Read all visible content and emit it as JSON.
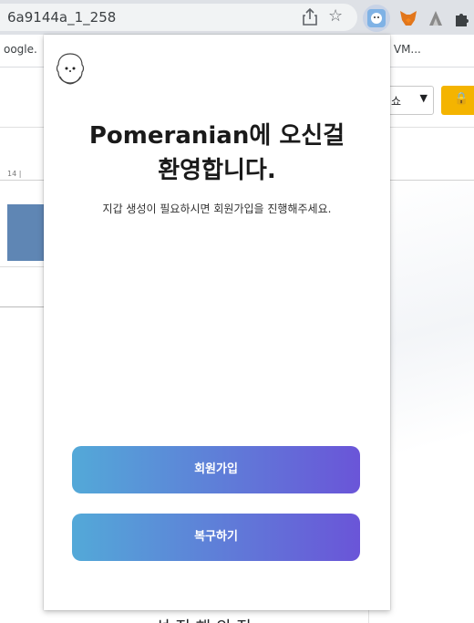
{
  "browser": {
    "url": "6a9144a_1_258",
    "bookmarks_left": "oogle.",
    "bookmarks_right": "| VM..."
  },
  "page": {
    "sort_label": "쇼",
    "ruler_text": "14 |",
    "bottom_text": "선 진 해 의 진"
  },
  "popup": {
    "title_line1": "Pomeranian에 오신걸",
    "title_line2": "환영합니다.",
    "subtitle": "지갑 생성이 필요하시면 회원가입을 진행해주세요.",
    "signup_button": "회원가입",
    "restore_button": "복구하기"
  },
  "colors": {
    "button_gradient_start": "#53a9d8",
    "button_gradient_end": "#6a55d8",
    "lock_button": "#f4b400"
  },
  "icons": [
    "share-icon",
    "star-icon",
    "pomeranian-extension-icon",
    "metamask-fox-icon",
    "kaikas-extension-icon",
    "puzzle-extensions-icon",
    "lock-icon",
    "pomeranian-logo-icon"
  ]
}
